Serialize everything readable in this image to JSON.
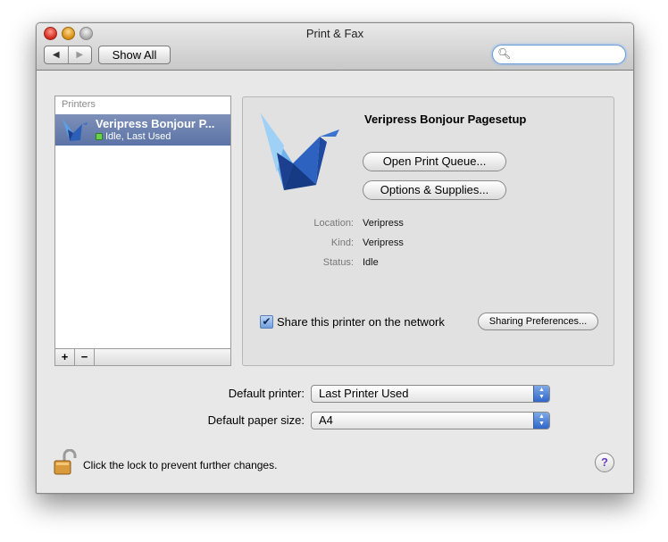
{
  "window": {
    "title": "Print & Fax",
    "nav_back": "◀",
    "nav_forward": "▶",
    "show_all": "Show All",
    "search_placeholder": ""
  },
  "printers_list": {
    "header": "Printers",
    "items": [
      {
        "name": "Veripress Bonjour P...",
        "status": "Idle, Last Used"
      }
    ],
    "add": "+",
    "remove": "−"
  },
  "detail": {
    "printer_name": "Veripress Bonjour Pagesetup",
    "open_queue": "Open Print Queue...",
    "options_supplies": "Options & Supplies...",
    "location_label": "Location:",
    "location_value": "Veripress",
    "kind_label": "Kind:",
    "kind_value": "Veripress",
    "status_label": "Status:",
    "status_value": "Idle",
    "share_checked": true,
    "share_label": "Share this printer on the network",
    "sharing_prefs": "Sharing Preferences..."
  },
  "defaults": {
    "printer_label": "Default printer:",
    "printer_value": "Last Printer Used",
    "paper_label": "Default paper size:",
    "paper_value": "A4"
  },
  "footer": {
    "lock_text": "Click the lock to prevent further changes.",
    "help": "?"
  },
  "colors": {
    "selection": "#6a80b0",
    "accent_blue": "#2f66c8",
    "help_purple": "#6a3db8"
  }
}
